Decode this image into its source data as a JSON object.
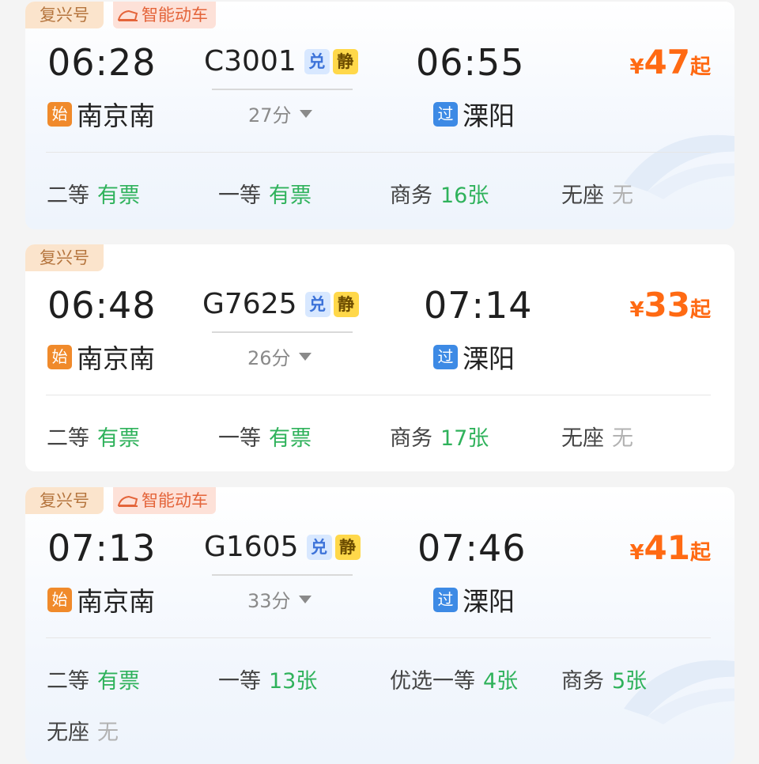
{
  "trains": [
    {
      "tags": [
        "复兴号",
        "智能动车"
      ],
      "depart_time": "06:28",
      "train_no": "C3001",
      "badge_dui": "兑",
      "badge_jing": "静",
      "arrive_time": "06:55",
      "duration": "27分",
      "from_badge": "始",
      "from_station": "南京南",
      "to_badge": "过",
      "to_station": "溧阳",
      "price_currency": "¥",
      "price_amount": "47",
      "price_suffix": "起",
      "seats": [
        {
          "name": "二等",
          "status": "有票"
        },
        {
          "name": "一等",
          "status": "有票"
        },
        {
          "name": "商务",
          "status": "16张"
        },
        {
          "name": "无座",
          "status": "无"
        }
      ]
    },
    {
      "tags": [
        "复兴号"
      ],
      "depart_time": "06:48",
      "train_no": "G7625",
      "badge_dui": "兑",
      "badge_jing": "静",
      "arrive_time": "07:14",
      "duration": "26分",
      "from_badge": "始",
      "from_station": "南京南",
      "to_badge": "过",
      "to_station": "溧阳",
      "price_currency": "¥",
      "price_amount": "33",
      "price_suffix": "起",
      "seats": [
        {
          "name": "二等",
          "status": "有票"
        },
        {
          "name": "一等",
          "status": "有票"
        },
        {
          "name": "商务",
          "status": "17张"
        },
        {
          "name": "无座",
          "status": "无"
        }
      ]
    },
    {
      "tags": [
        "复兴号",
        "智能动车"
      ],
      "depart_time": "07:13",
      "train_no": "G1605",
      "badge_dui": "兑",
      "badge_jing": "静",
      "arrive_time": "07:46",
      "duration": "33分",
      "from_badge": "始",
      "from_station": "南京南",
      "to_badge": "过",
      "to_station": "溧阳",
      "price_currency": "¥",
      "price_amount": "41",
      "price_suffix": "起",
      "seats": [
        {
          "name": "二等",
          "status": "有票"
        },
        {
          "name": "一等",
          "status": "13张"
        },
        {
          "name": "优选一等",
          "status": "4张"
        },
        {
          "name": "商务",
          "status": "5张"
        },
        {
          "name": "无座",
          "status": "无"
        }
      ]
    }
  ],
  "colors": {
    "price": "#ff6a13",
    "available": "#2fb25b",
    "unavailable": "#b2b2b2",
    "tag_fuxing_bg": "#fbe4cc",
    "tag_zhineng_bg": "#fde1d8",
    "start_badge": "#f08a2b",
    "pass_badge": "#3d8ae5"
  }
}
